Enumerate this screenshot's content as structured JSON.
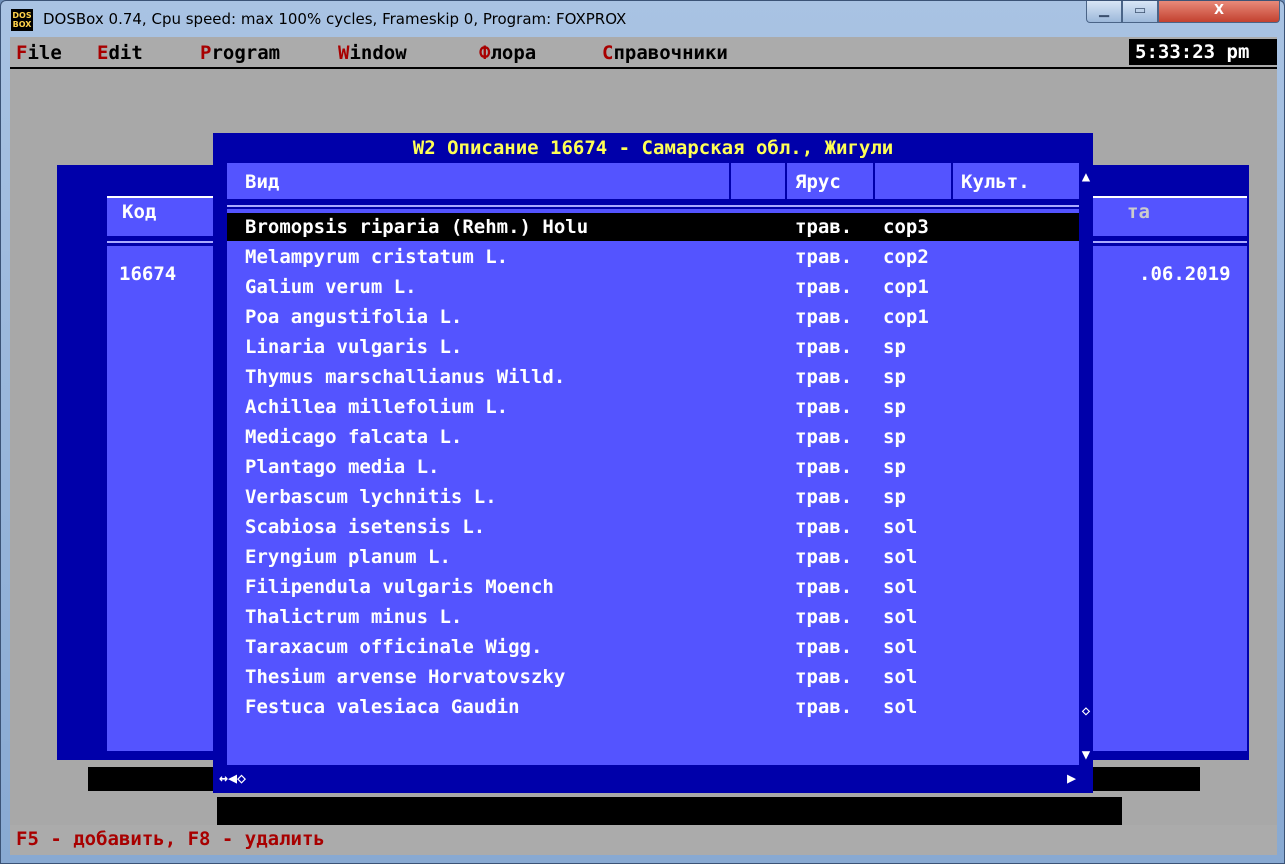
{
  "window": {
    "title": "DOSBox 0.74, Cpu speed: max 100% cycles, Frameskip  0, Program:  FOXPROX",
    "icon_text": "DOS BOX",
    "min_glyph": "▁",
    "max_glyph": "▭",
    "close_glyph": "X"
  },
  "menubar": {
    "items": [
      {
        "hotkey": "F",
        "rest": "ile"
      },
      {
        "hotkey": "E",
        "rest": "dit"
      },
      {
        "hotkey": "P",
        "rest": "rogram"
      },
      {
        "hotkey": "W",
        "rest": "indow"
      },
      {
        "hotkey": "Ф",
        "rest": "лора"
      },
      {
        "hotkey": "С",
        "rest": "правочники"
      }
    ],
    "clock": "5:33:23 pm"
  },
  "background_window": {
    "col_kod": "Код",
    "col_partial": "та",
    "code_value": "16674",
    "date_partial": ".06.2019"
  },
  "dialog": {
    "title": "W2 Описание 16674 - Самарская обл., Жигули",
    "columns": {
      "vid": "Вид",
      "yarus": "Ярус",
      "cult": "Культ."
    },
    "rows": [
      {
        "name": "Bromopsis riparia (Rehm.) Holu",
        "yarus": "трав.",
        "cult": "cop3"
      },
      {
        "name": "Melampyrum cristatum L.",
        "yarus": "трав.",
        "cult": "cop2"
      },
      {
        "name": "Galium verum L.",
        "yarus": "трав.",
        "cult": "cop1"
      },
      {
        "name": "Poa angustifolia L.",
        "yarus": "трав.",
        "cult": "cop1"
      },
      {
        "name": "Linaria vulgaris L.",
        "yarus": "трав.",
        "cult": "sp"
      },
      {
        "name": "Thymus marschallianus Willd.",
        "yarus": "трав.",
        "cult": "sp"
      },
      {
        "name": "Achillea millefolium L.",
        "yarus": "трав.",
        "cult": "sp"
      },
      {
        "name": "Medicago falcata L.",
        "yarus": "трав.",
        "cult": "sp"
      },
      {
        "name": "Plantago media L.",
        "yarus": "трав.",
        "cult": "sp"
      },
      {
        "name": "Verbascum lychnitis L.",
        "yarus": "трав.",
        "cult": "sp"
      },
      {
        "name": "Scabiosa isetensis L.",
        "yarus": "трав.",
        "cult": "sol"
      },
      {
        "name": "Eryngium planum L.",
        "yarus": "трав.",
        "cult": "sol"
      },
      {
        "name": "Filipendula vulgaris Moench",
        "yarus": "трав.",
        "cult": "sol"
      },
      {
        "name": "Thalictrum minus L.",
        "yarus": "трав.",
        "cult": "sol"
      },
      {
        "name": "Taraxacum officinale Wigg.",
        "yarus": "трав.",
        "cult": "sol"
      },
      {
        "name": "Thesium arvense Horvatovszky",
        "yarus": "трав.",
        "cult": "sol"
      },
      {
        "name": "Festuca valesiaca Gaudin",
        "yarus": "трав.",
        "cult": "sol"
      }
    ],
    "scroll": {
      "up": "▲",
      "thumb": "◇",
      "down": "▼",
      "left_combo": "↔◀◇",
      "right": "▶"
    }
  },
  "status_line": "F5 - добавить, F8 - удалить",
  "colors": {
    "dialog_bg": "#0000aa",
    "list_bg": "#5454ff",
    "title_yellow": "#ffff55",
    "hotkey_red": "#a80000"
  }
}
